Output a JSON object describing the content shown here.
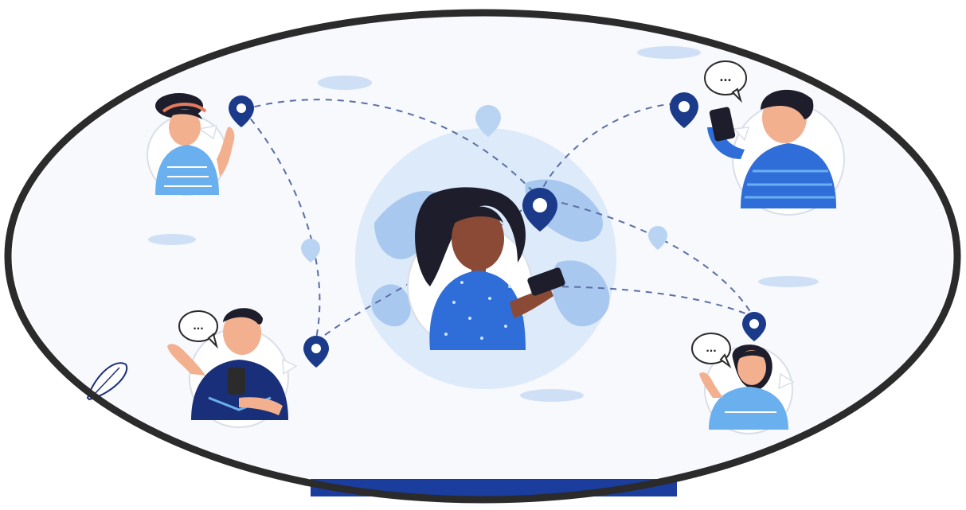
{
  "illustration": {
    "subject": "",
    "speech_bubble_text": "...",
    "colors": {
      "frame_ring": "#2b2b2b",
      "background": "#f7f9fd",
      "globe_land": "#a9c8ef",
      "globe_water": "#dceaf9",
      "pin_dark": "#1b3a8a",
      "pin_light": "#b9d3f2",
      "dashed_route": "#5b6fa6",
      "shirt_blue": "#2f6ed8",
      "shirt_light": "#6ab0ef",
      "shirt_navy": "#1a2f7a",
      "skin_dark": "#8a4a35",
      "skin_light": "#f2b08f",
      "hair": "#1d1d2b",
      "bottom_bar": "#1a3d9e"
    },
    "icons": [
      "location-pin-icon",
      "speech-bubble-icon",
      "phone-icon",
      "cloud-icon"
    ]
  }
}
